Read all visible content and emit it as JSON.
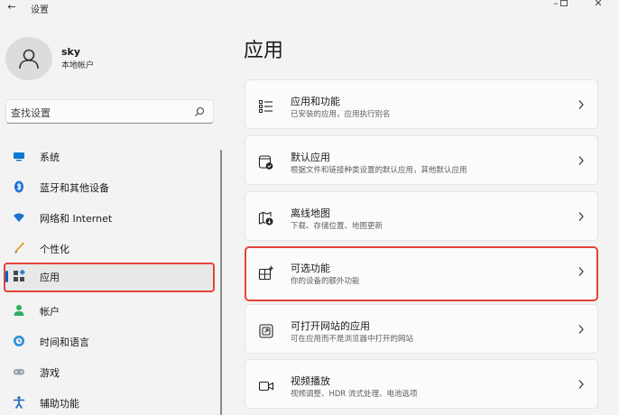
{
  "window": {
    "title": "设置"
  },
  "user": {
    "name": "sky",
    "account_type": "本地帐户"
  },
  "search": {
    "placeholder": "查找设置"
  },
  "sidebar": {
    "items": [
      {
        "label": "系统",
        "icon": "monitor-icon"
      },
      {
        "label": "蓝牙和其他设备",
        "icon": "bluetooth-icon"
      },
      {
        "label": "网络和 Internet",
        "icon": "wifi-icon"
      },
      {
        "label": "个性化",
        "icon": "brush-icon"
      },
      {
        "label": "应用",
        "icon": "apps-icon",
        "selected": true
      },
      {
        "label": "帐户",
        "icon": "person-icon"
      },
      {
        "label": "时间和语言",
        "icon": "globe-clock-icon"
      },
      {
        "label": "游戏",
        "icon": "gamepad-icon"
      },
      {
        "label": "辅助功能",
        "icon": "accessibility-icon"
      }
    ]
  },
  "main": {
    "title": "应用",
    "cards": [
      {
        "title": "应用和功能",
        "subtitle": "已安装的应用，应用执行别名",
        "icon": "apps-list-icon"
      },
      {
        "title": "默认应用",
        "subtitle": "根据文件和链接种类设置的默认应用，其他默认应用",
        "icon": "default-apps-icon"
      },
      {
        "title": "离线地图",
        "subtitle": "下载、存储位置、地图更新",
        "icon": "offline-map-icon"
      },
      {
        "title": "可选功能",
        "subtitle": "你的设备的额外功能",
        "icon": "optional-features-icon",
        "highlighted": true
      },
      {
        "title": "可打开网站的应用",
        "subtitle": "可在应用而不是浏览器中打开的网站",
        "icon": "open-website-icon"
      },
      {
        "title": "视频播放",
        "subtitle": "视频调整、HDR 流式处理、电池选项",
        "icon": "video-camera-icon"
      }
    ]
  },
  "colors": {
    "accent": "#0067c0",
    "highlight_border": "#e3443a",
    "background": "#f3f3f3",
    "card": "#fbfbfb"
  }
}
